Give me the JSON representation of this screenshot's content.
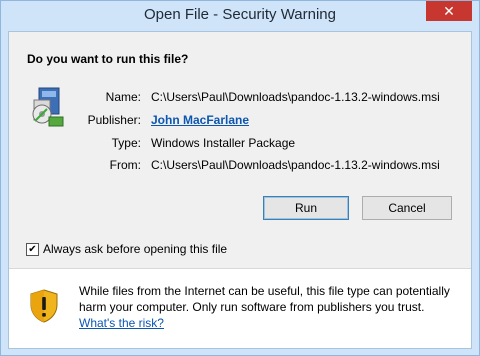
{
  "window": {
    "title": "Open File - Security Warning",
    "close_glyph": "✕"
  },
  "dialog": {
    "question": "Do you want to run this file?",
    "file_icon": "windows-installer-icon",
    "fields": {
      "name_label": "Name:",
      "name_value": "C:\\Users\\Paul\\Downloads\\pandoc-1.13.2-windows.msi",
      "publisher_label": "Publisher:",
      "publisher_value": "John MacFarlane",
      "type_label": "Type:",
      "type_value": "Windows Installer Package",
      "from_label": "From:",
      "from_value": "C:\\Users\\Paul\\Downloads\\pandoc-1.13.2-windows.msi"
    },
    "buttons": {
      "run_label": "Run",
      "cancel_label": "Cancel"
    },
    "checkbox": {
      "label": "Always ask before opening this file",
      "checked": true,
      "check_glyph": "✔"
    },
    "warning": {
      "icon": "shield-warning-icon",
      "text": "While files from the Internet can be useful, this file type can potentially harm your computer. Only run software from publishers you trust.",
      "link": "What's the risk?"
    }
  }
}
